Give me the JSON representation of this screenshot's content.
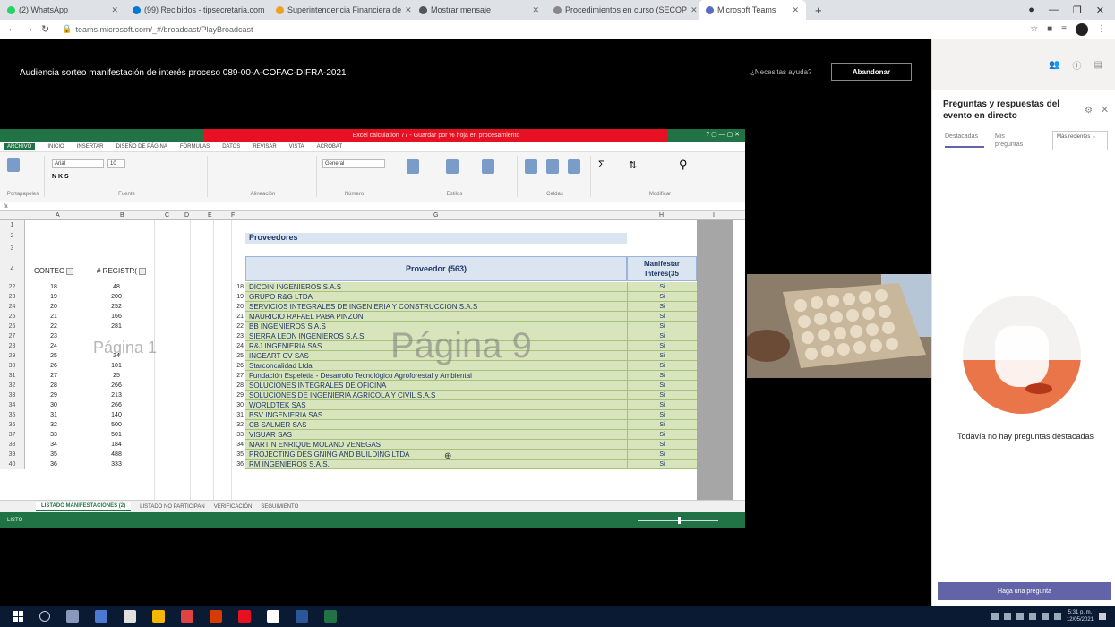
{
  "browser": {
    "tabs": [
      {
        "label": "(2) WhatsApp",
        "active": false
      },
      {
        "label": "(99) Recibidos - tipsecretaria.com",
        "active": false
      },
      {
        "label": "Superintendencia Financiera de",
        "active": false
      },
      {
        "label": "Mostrar mensaje",
        "active": false
      },
      {
        "label": "Procedimientos en curso (SECOP",
        "active": false
      },
      {
        "label": "Microsoft Teams",
        "active": true
      }
    ],
    "url": "teams.microsoft.com/_#/broadcast/PlayBroadcast",
    "new_tab": "+"
  },
  "event": {
    "title": "Audiencia sorteo manifestación de interés proceso 089-00-A-COFAC-DIFRA-2021",
    "help_link": "¿Necesitas ayuda?",
    "leave_button": "Abandonar"
  },
  "excel": {
    "title_bar": "Excel calculation 77 - Guardar por % hoja en procesamiento",
    "menu": [
      "ARCHIVO",
      "INICIO",
      "INSERTAR",
      "DISEÑO DE PÁGINA",
      "FÓRMULAS",
      "DATOS",
      "REVISAR",
      "VISTA",
      "ACROBAT"
    ],
    "font_name": "Arial",
    "font_size": "10",
    "number_format": "General",
    "ribbon_groups": [
      "Portapapeles",
      "Fuente",
      "Alineación",
      "Número",
      "Estilos",
      "Celdas",
      "Modificar"
    ],
    "col_headers": [
      "A",
      "B",
      "C",
      "D",
      "E",
      "F",
      "G",
      "H",
      "I"
    ],
    "section_title": "Proveedores",
    "header_conteo": "CONTEO",
    "header_registro": "# REGISTR(",
    "header_proveedor": "Proveedor (563)",
    "header_manifestar": "Manifestar Interés(35",
    "watermark_left": "Página 1",
    "watermark_center": "Página 9",
    "sheet_tabs": [
      "LISTADO MANIFESTACIONES (2)",
      "LISTADO NO PARTICIPAN",
      "VERIFICACIÓN",
      "SEGUIMIENTO"
    ],
    "status": "LISTO",
    "rows": [
      {
        "row": "22",
        "conteo": "18",
        "registro": "48",
        "num": "18",
        "proveedor": "DICOIN INGENIEROS S.A.S",
        "manif": "Si"
      },
      {
        "row": "23",
        "conteo": "19",
        "registro": "200",
        "num": "19",
        "proveedor": "GRUPO R&G LTDA",
        "manif": "Si"
      },
      {
        "row": "24",
        "conteo": "20",
        "registro": "252",
        "num": "20",
        "proveedor": "SERVICIOS INTEGRALES DE INGENIERIA Y CONSTRUCCION S.A.S",
        "manif": "Si"
      },
      {
        "row": "25",
        "conteo": "21",
        "registro": "166",
        "num": "21",
        "proveedor": "MAURICIO RAFAEL PABA PINZON",
        "manif": "Si"
      },
      {
        "row": "26",
        "conteo": "22",
        "registro": "281",
        "num": "22",
        "proveedor": "BB INGENIEROS S.A.S",
        "manif": "Si"
      },
      {
        "row": "27",
        "conteo": "23",
        "registro": "",
        "num": "23",
        "proveedor": "SIERRA LEON INGENIEROS S.A.S",
        "manif": "Si"
      },
      {
        "row": "28",
        "conteo": "24",
        "registro": "",
        "num": "24",
        "proveedor": "R&J INGENIERIA SAS",
        "manif": "Si"
      },
      {
        "row": "29",
        "conteo": "25",
        "registro": "24",
        "num": "25",
        "proveedor": "INGEART CV SAS",
        "manif": "Si"
      },
      {
        "row": "30",
        "conteo": "26",
        "registro": "101",
        "num": "26",
        "proveedor": "Starconcalidad Ltda",
        "manif": "Si"
      },
      {
        "row": "31",
        "conteo": "27",
        "registro": "25",
        "num": "27",
        "proveedor": "Fundación Espeletia - Desarrollo Tecnológico Agroforestal y Ambiental",
        "manif": "Si"
      },
      {
        "row": "32",
        "conteo": "28",
        "registro": "266",
        "num": "28",
        "proveedor": "SOLUCIONES INTEGRALES DE OFICINA",
        "manif": "Si"
      },
      {
        "row": "33",
        "conteo": "29",
        "registro": "213",
        "num": "29",
        "proveedor": "SOLUCIONES DE INGENIERIA AGRICOLA Y CIVIL S.A.S",
        "manif": "Si"
      },
      {
        "row": "34",
        "conteo": "30",
        "registro": "266",
        "num": "30",
        "proveedor": "WORLDTEK SAS",
        "manif": "Si"
      },
      {
        "row": "35",
        "conteo": "31",
        "registro": "140",
        "num": "31",
        "proveedor": "BSV INGENIERIA SAS",
        "manif": "Si"
      },
      {
        "row": "36",
        "conteo": "32",
        "registro": "500",
        "num": "32",
        "proveedor": "CB SALMER SAS",
        "manif": "Si"
      },
      {
        "row": "37",
        "conteo": "33",
        "registro": "501",
        "num": "33",
        "proveedor": "VISUAR SAS",
        "manif": "Si"
      },
      {
        "row": "38",
        "conteo": "34",
        "registro": "184",
        "num": "34",
        "proveedor": "MARTIN ENRIQUE MOLANO VENEGAS",
        "manif": "Si"
      },
      {
        "row": "39",
        "conteo": "35",
        "registro": "488",
        "num": "35",
        "proveedor": "PROJECTING DESIGNING AND BUILDING LTDA",
        "manif": "Si"
      },
      {
        "row": "40",
        "conteo": "36",
        "registro": "333",
        "num": "36",
        "proveedor": "RM INGENIEROS S.A.S.",
        "manif": "Si"
      }
    ]
  },
  "panel": {
    "title": "Preguntas y respuestas del evento en directo",
    "tab_featured": "Destacadas",
    "tab_mine": "Mis preguntas",
    "sort_label": "Más recientes",
    "empty_text": "Todavía no hay preguntas destacadas",
    "ask_button": "Haga una pregunta"
  },
  "taskbar": {
    "time": "5:31 p. m.",
    "date": "12/05/2021"
  }
}
